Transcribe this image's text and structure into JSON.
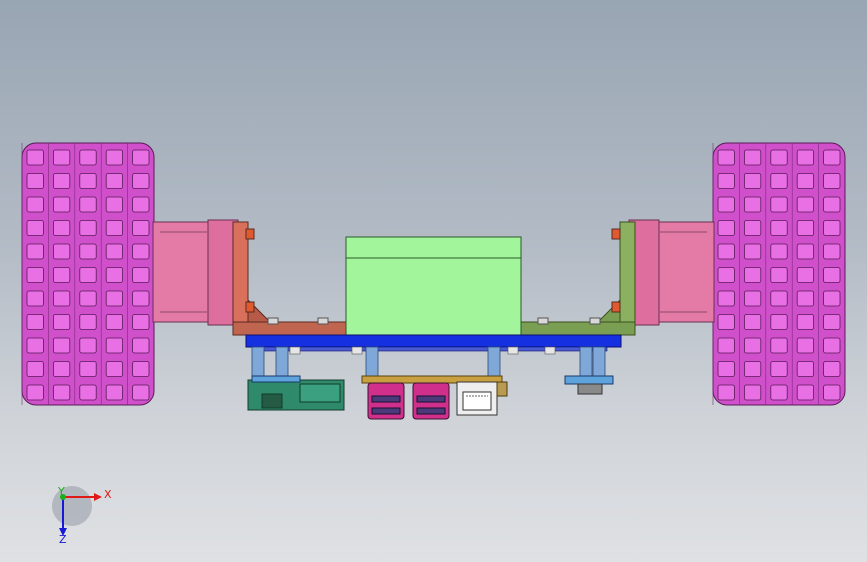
{
  "viewport": {
    "background_top": "#98a5b3",
    "background_bottom": "#dfe1e4"
  },
  "model": {
    "parts": [
      "left-wheel",
      "right-wheel",
      "left-motor",
      "right-motor",
      "left-bracket",
      "right-bracket",
      "battery-box",
      "base-plate",
      "standoffs",
      "controller-board",
      "usb-ports",
      "ethernet-port",
      "sensor-board"
    ],
    "colors": {
      "wheel": "#d050cc",
      "wheel_block": "#e86fe4",
      "motor": "#e47aa6",
      "left_bracket": "#d8705c",
      "right_bracket": "#8bb060",
      "battery": "#a2f59a",
      "plate": "#1530e0",
      "standoff": "#7fa8d8",
      "board": "#2e8a6a",
      "usb": "#d0308c"
    }
  },
  "triad": {
    "x_label": "X",
    "y_label": "Y",
    "z_label": "Z",
    "x_color": "#e01818",
    "y_color": "#18b018",
    "z_color": "#1818d8"
  }
}
